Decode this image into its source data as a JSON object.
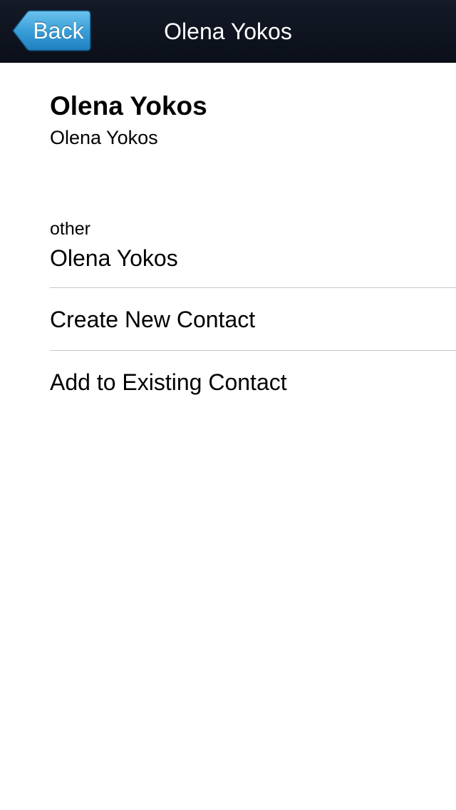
{
  "navbar": {
    "back_label": "Back",
    "title": "Olena Yokos"
  },
  "contact": {
    "name": "Olena Yokos",
    "subname": "Olena Yokos",
    "field_label": "other",
    "field_value": "Olena Yokos"
  },
  "actions": {
    "create_new": "Create New Contact",
    "add_existing": "Add to Existing Contact"
  },
  "colors": {
    "navbar_bg": "#0a0f1a",
    "back_button": "#3fa0d6",
    "separator": "#c8c7cc"
  }
}
